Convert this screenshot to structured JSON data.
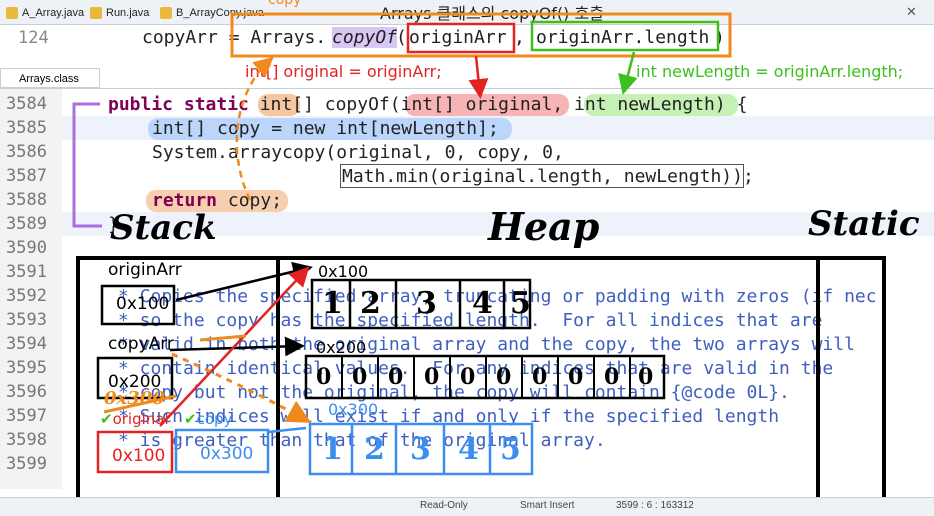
{
  "tabs": [
    "A_Array.java",
    "Run.java",
    "B_ArrayCopy.java"
  ],
  "title": "Arrays 클래스의 copyOf() 호출",
  "top_label_fragment": "copy",
  "line1": {
    "num": "124",
    "pre": "copyArr = Arrays.",
    "method": "copyOf",
    "arg1": "originArr",
    "arg2": "originArr.length",
    "post": ");"
  },
  "notes": {
    "original": "int[] original = originArr;",
    "newlen": "int newLength = originArr.length;"
  },
  "class_tab": "Arrays.class",
  "rows": [
    "3584",
    "3585",
    "3586",
    "3587",
    "3588",
    "3589",
    "3590",
    "3591",
    "3592",
    "3593",
    "3594",
    "3595",
    "3596",
    "3597",
    "3598",
    "3599"
  ],
  "code": {
    "l3584a": "public static ",
    "l3584b": "int[] copyOf(",
    "l3584c": "int[] original",
    "l3584d": ", ",
    "l3584e": "int newLength",
    "l3584f": ") {",
    "l3585": "int[] copy = new int[newLength];",
    "l3586": "System.arraycopy(original, 0, copy, 0,",
    "l3587": "Math.min(original.length, newLength));",
    "l3588a": "return",
    "l3588b": " copy;",
    "l3589": "}"
  },
  "comments": [
    "* Copies the specified array, truncating or padding with zeros (if nec",
    "* so the copy has the specified length.  For all indices that are",
    "* valid in both the original array and the copy, the two arrays will",
    "* contain identical values.  For any indices that are valid in the",
    "* copy but not the original, the copy will contain {@code 0L}.",
    "* Such indices will exist if and only if the specified length",
    "* is greater than that of the original array."
  ],
  "sections": {
    "stack": "Stack",
    "heap": "Heap",
    "static": "Static"
  },
  "stack": {
    "originArr": "originArr",
    "originAddr": "0x100",
    "copyArr": "copyArr",
    "copyAddr": "0x200",
    "copyAddrOld": "0x300",
    "original": "original",
    "copy": "copy",
    "origAddr2": "0x100",
    "copyAddr2": "0x300"
  },
  "heap": {
    "a1_addr": "0x100",
    "a1": [
      "1",
      "2",
      "3",
      "4",
      "5"
    ],
    "a2_addr": "0x200",
    "a2": [
      "0",
      "0",
      "0",
      "0",
      "0",
      "0",
      "0",
      "0",
      "0",
      "0"
    ],
    "a3_addr": "0x300",
    "a3": [
      "1",
      "2",
      "3",
      "4",
      "5"
    ]
  },
  "status": {
    "mode": "Read-Only",
    "insert": "Smart Insert",
    "pos": "3599 : 6 : 163312"
  },
  "colors": {
    "orange": "#f08a1c",
    "red": "#e52222",
    "green": "#3dbf1e",
    "blue": "#3a8ef0",
    "purple": "#a86ee0"
  }
}
